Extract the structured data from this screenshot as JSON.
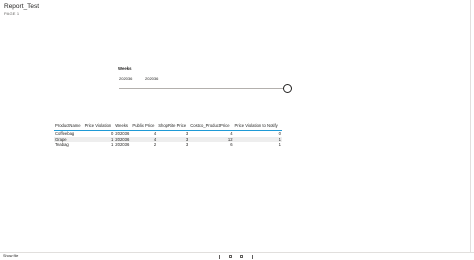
{
  "report": {
    "title": "Report_Test",
    "page": "PAGE 1"
  },
  "slicer": {
    "header": "Weeks",
    "from": "202036",
    "to": "202036"
  },
  "table": {
    "columns": [
      "ProductName",
      "Price Violation",
      "Weeks",
      "Publix Price",
      "ShopRite Price",
      "Costco_ProductPrice",
      "Price Violation to Notify"
    ],
    "rows": [
      {
        "product": "Coffeebag",
        "violation": "0",
        "weeks": "202036",
        "publix": "4",
        "shoprite": "3",
        "costco": "4",
        "notify": "0"
      },
      {
        "product": "Grape",
        "violation": "1",
        "weeks": "202036",
        "publix": "4",
        "shoprite": "3",
        "costco": "12",
        "notify": "1"
      },
      {
        "product": "Teabag",
        "violation": "1",
        "weeks": "202036",
        "publix": "2",
        "shoprite": "3",
        "costco": "6",
        "notify": "1"
      }
    ]
  },
  "bottom_bar": {
    "label": "Show file"
  },
  "colors": {
    "header_rule": "#1f9ad6",
    "alt_row": "#eeeeee"
  }
}
